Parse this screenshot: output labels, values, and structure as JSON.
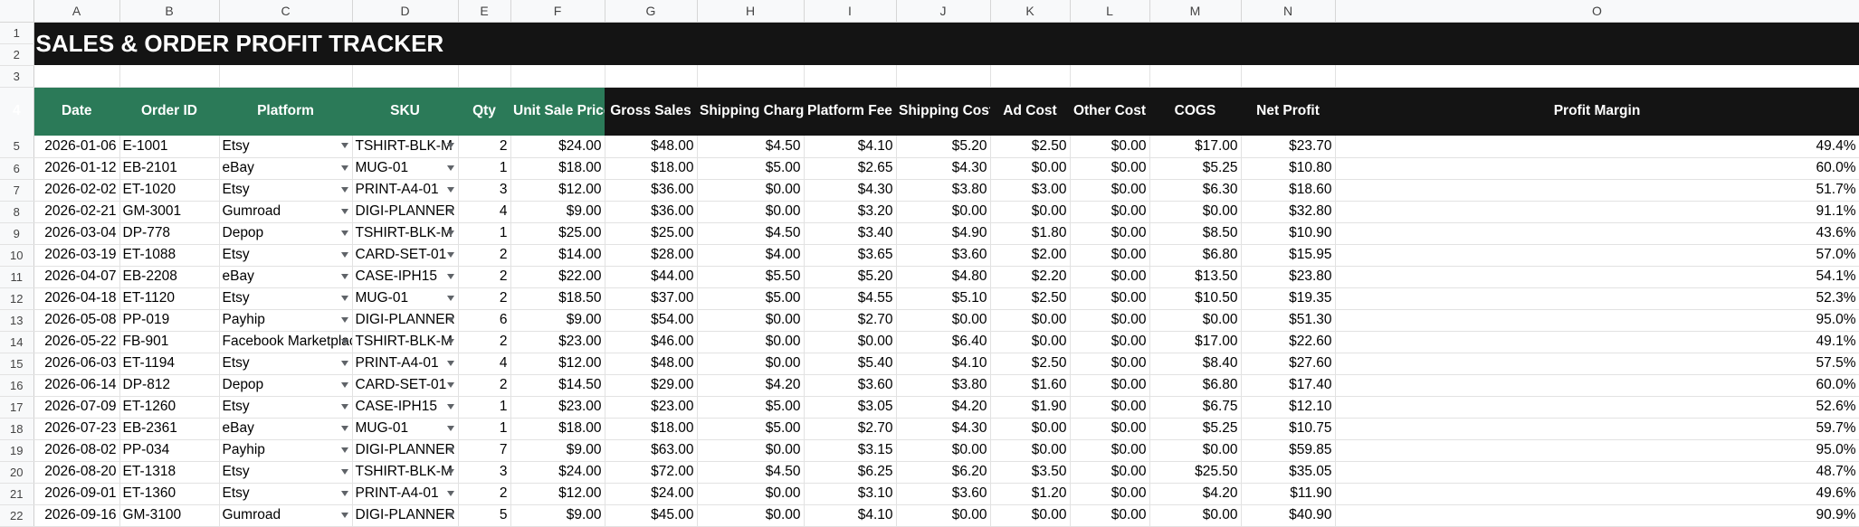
{
  "sheet": {
    "column_letters": [
      "A",
      "B",
      "C",
      "D",
      "E",
      "F",
      "G",
      "H",
      "I",
      "J",
      "K",
      "L",
      "M",
      "N",
      "O"
    ],
    "title": "SALES & ORDER PROFIT TRACKER",
    "headers": [
      "Date",
      "Order ID",
      "Platform",
      "SKU",
      "Qty",
      "Unit Sale Price",
      "Gross Sales",
      "Shipping Charged",
      "Platform Fee",
      "Shipping Cost",
      "Ad Cost",
      "Other Cost",
      "COGS",
      "Net Profit",
      "Profit Margin"
    ],
    "rows": [
      {
        "n": "5",
        "c": [
          "2026-01-06",
          "E-1001",
          "Etsy",
          "TSHIRT-BLK-M",
          "2",
          "$24.00",
          "$48.00",
          "$4.50",
          "$4.10",
          "$5.20",
          "$2.50",
          "$0.00",
          "$17.00",
          "$23.70",
          "49.4%"
        ]
      },
      {
        "n": "6",
        "c": [
          "2026-01-12",
          "EB-2101",
          "eBay",
          "MUG-01",
          "1",
          "$18.00",
          "$18.00",
          "$5.00",
          "$2.65",
          "$4.30",
          "$0.00",
          "$0.00",
          "$5.25",
          "$10.80",
          "60.0%"
        ]
      },
      {
        "n": "7",
        "c": [
          "2026-02-02",
          "ET-1020",
          "Etsy",
          "PRINT-A4-01",
          "3",
          "$12.00",
          "$36.00",
          "$0.00",
          "$4.30",
          "$3.80",
          "$3.00",
          "$0.00",
          "$6.30",
          "$18.60",
          "51.7%"
        ]
      },
      {
        "n": "8",
        "c": [
          "2026-02-21",
          "GM-3001",
          "Gumroad",
          "DIGI-PLANNER",
          "4",
          "$9.00",
          "$36.00",
          "$0.00",
          "$3.20",
          "$0.00",
          "$0.00",
          "$0.00",
          "$0.00",
          "$32.80",
          "91.1%"
        ]
      },
      {
        "n": "9",
        "c": [
          "2026-03-04",
          "DP-778",
          "Depop",
          "TSHIRT-BLK-M",
          "1",
          "$25.00",
          "$25.00",
          "$4.50",
          "$3.40",
          "$4.90",
          "$1.80",
          "$0.00",
          "$8.50",
          "$10.90",
          "43.6%"
        ]
      },
      {
        "n": "10",
        "c": [
          "2026-03-19",
          "ET-1088",
          "Etsy",
          "CARD-SET-01",
          "2",
          "$14.00",
          "$28.00",
          "$4.00",
          "$3.65",
          "$3.60",
          "$2.00",
          "$0.00",
          "$6.80",
          "$15.95",
          "57.0%"
        ]
      },
      {
        "n": "11",
        "c": [
          "2026-04-07",
          "EB-2208",
          "eBay",
          "CASE-IPH15",
          "2",
          "$22.00",
          "$44.00",
          "$5.50",
          "$5.20",
          "$4.80",
          "$2.20",
          "$0.00",
          "$13.50",
          "$23.80",
          "54.1%"
        ]
      },
      {
        "n": "12",
        "c": [
          "2026-04-18",
          "ET-1120",
          "Etsy",
          "MUG-01",
          "2",
          "$18.50",
          "$37.00",
          "$5.00",
          "$4.55",
          "$5.10",
          "$2.50",
          "$0.00",
          "$10.50",
          "$19.35",
          "52.3%"
        ]
      },
      {
        "n": "13",
        "c": [
          "2026-05-08",
          "PP-019",
          "Payhip",
          "DIGI-PLANNER",
          "6",
          "$9.00",
          "$54.00",
          "$0.00",
          "$2.70",
          "$0.00",
          "$0.00",
          "$0.00",
          "$0.00",
          "$51.30",
          "95.0%"
        ]
      },
      {
        "n": "14",
        "c": [
          "2026-05-22",
          "FB-901",
          "Facebook Marketplace",
          "TSHIRT-BLK-M",
          "2",
          "$23.00",
          "$46.00",
          "$0.00",
          "$0.00",
          "$6.40",
          "$0.00",
          "$0.00",
          "$17.00",
          "$22.60",
          "49.1%"
        ]
      },
      {
        "n": "15",
        "c": [
          "2026-06-03",
          "ET-1194",
          "Etsy",
          "PRINT-A4-01",
          "4",
          "$12.00",
          "$48.00",
          "$0.00",
          "$5.40",
          "$4.10",
          "$2.50",
          "$0.00",
          "$8.40",
          "$27.60",
          "57.5%"
        ]
      },
      {
        "n": "16",
        "c": [
          "2026-06-14",
          "DP-812",
          "Depop",
          "CARD-SET-01",
          "2",
          "$14.50",
          "$29.00",
          "$4.20",
          "$3.60",
          "$3.80",
          "$1.60",
          "$0.00",
          "$6.80",
          "$17.40",
          "60.0%"
        ]
      },
      {
        "n": "17",
        "c": [
          "2026-07-09",
          "ET-1260",
          "Etsy",
          "CASE-IPH15",
          "1",
          "$23.00",
          "$23.00",
          "$5.00",
          "$3.05",
          "$4.20",
          "$1.90",
          "$0.00",
          "$6.75",
          "$12.10",
          "52.6%"
        ]
      },
      {
        "n": "18",
        "c": [
          "2026-07-23",
          "EB-2361",
          "eBay",
          "MUG-01",
          "1",
          "$18.00",
          "$18.00",
          "$5.00",
          "$2.70",
          "$4.30",
          "$0.00",
          "$0.00",
          "$5.25",
          "$10.75",
          "59.7%"
        ]
      },
      {
        "n": "19",
        "c": [
          "2026-08-02",
          "PP-034",
          "Payhip",
          "DIGI-PLANNER",
          "7",
          "$9.00",
          "$63.00",
          "$0.00",
          "$3.15",
          "$0.00",
          "$0.00",
          "$0.00",
          "$0.00",
          "$59.85",
          "95.0%"
        ]
      },
      {
        "n": "20",
        "c": [
          "2026-08-20",
          "ET-1318",
          "Etsy",
          "TSHIRT-BLK-M",
          "3",
          "$24.00",
          "$72.00",
          "$4.50",
          "$6.25",
          "$6.20",
          "$3.50",
          "$0.00",
          "$25.50",
          "$35.05",
          "48.7%"
        ]
      },
      {
        "n": "21",
        "c": [
          "2026-09-01",
          "ET-1360",
          "Etsy",
          "PRINT-A4-01",
          "2",
          "$12.00",
          "$24.00",
          "$0.00",
          "$3.10",
          "$3.60",
          "$1.20",
          "$0.00",
          "$4.20",
          "$11.90",
          "49.6%"
        ]
      },
      {
        "n": "22",
        "c": [
          "2026-09-16",
          "GM-3100",
          "Gumroad",
          "DIGI-PLANNER",
          "5",
          "$9.00",
          "$45.00",
          "$0.00",
          "$4.10",
          "$0.00",
          "$0.00",
          "$0.00",
          "$0.00",
          "$40.90",
          "90.9%"
        ]
      }
    ],
    "colors": {
      "title_bg": "#141414",
      "header_green": "#2b7a58",
      "header_black": "#141414",
      "dropdown_icon": "#5f6368"
    }
  }
}
